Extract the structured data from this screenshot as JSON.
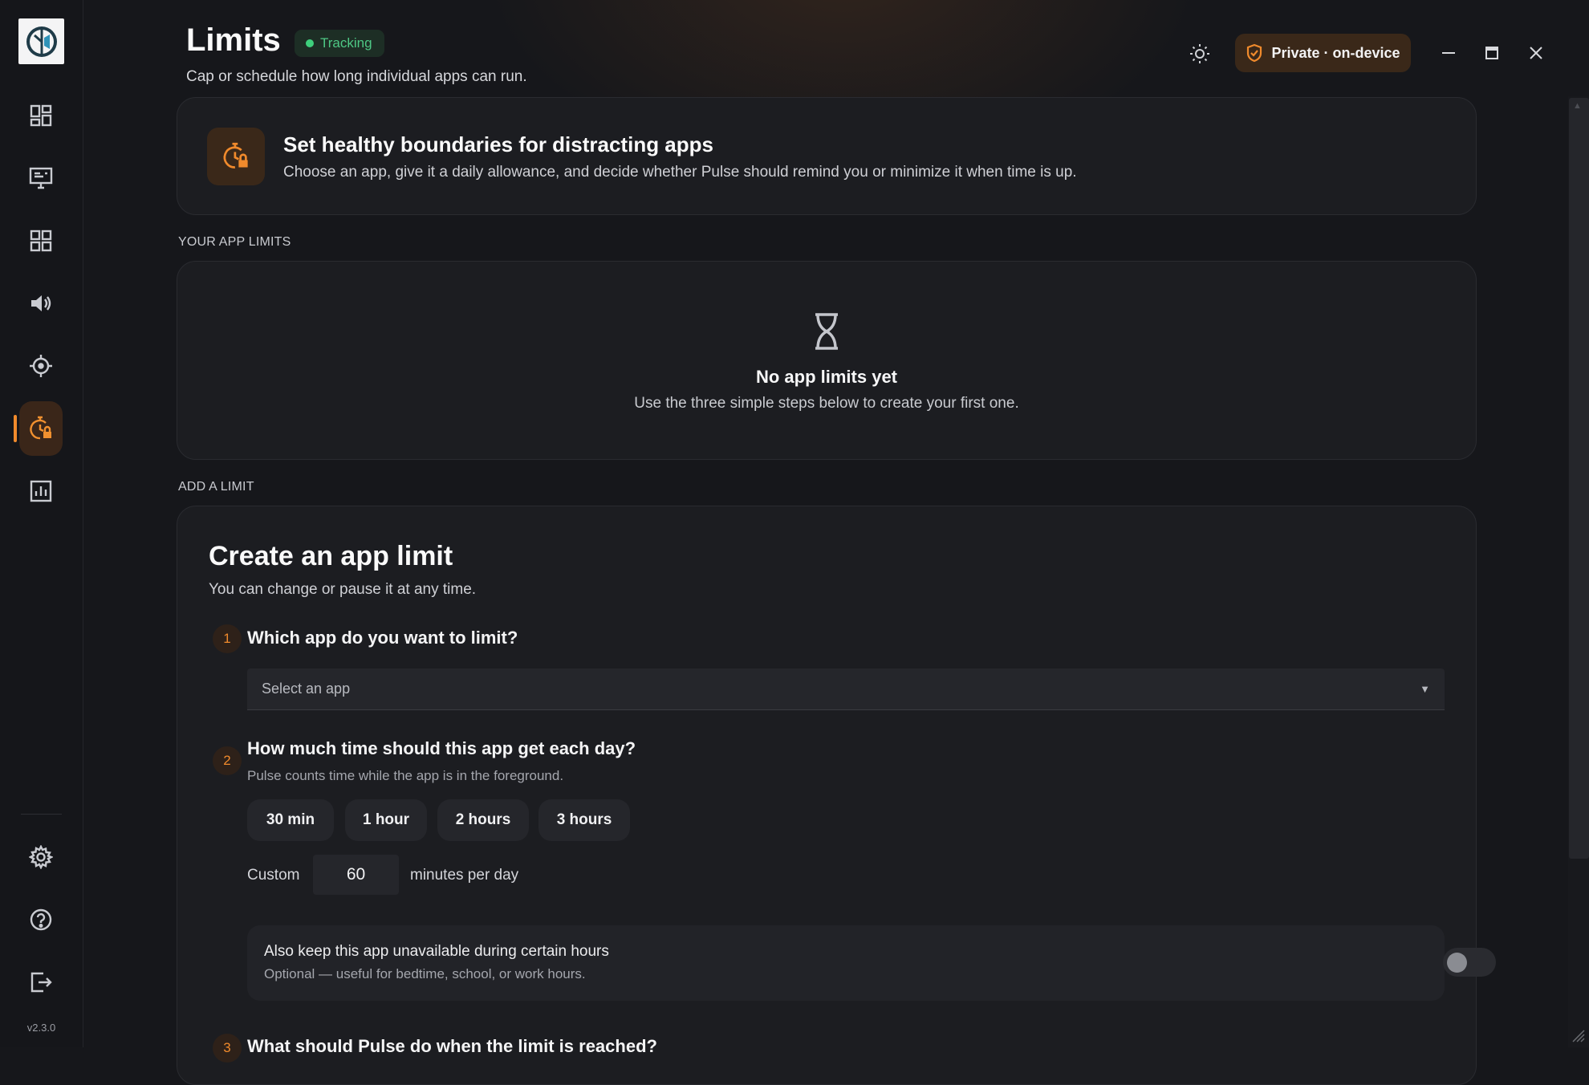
{
  "app": {
    "version": "v2.3.0"
  },
  "header": {
    "title": "Limits",
    "status_badge": "Tracking",
    "subtitle": "Cap or schedule how long individual apps can run.",
    "privacy_label": "Private · on-device"
  },
  "sidebar": {
    "items": [
      {
        "id": "dashboard",
        "icon": "dashboard-icon"
      },
      {
        "id": "screen",
        "icon": "monitor-icon"
      },
      {
        "id": "apps",
        "icon": "apps-grid-icon"
      },
      {
        "id": "sound",
        "icon": "speaker-icon"
      },
      {
        "id": "focus",
        "icon": "crosshair-icon"
      },
      {
        "id": "limits",
        "icon": "timer-lock-icon",
        "active": true
      },
      {
        "id": "reports",
        "icon": "bar-chart-icon"
      }
    ],
    "bottom": [
      {
        "id": "settings",
        "icon": "gear-icon"
      },
      {
        "id": "help",
        "icon": "help-icon"
      },
      {
        "id": "exit",
        "icon": "logout-icon"
      }
    ]
  },
  "hero": {
    "title": "Set healthy boundaries for distracting apps",
    "description": "Choose an app, give it a daily allowance, and decide whether Pulse should remind you or minimize it when time is up."
  },
  "limits_section": {
    "label": "YOUR APP LIMITS",
    "empty_title": "No app limits yet",
    "empty_description": "Use the three simple steps below to create your first one."
  },
  "add_section": {
    "label": "ADD A LIMIT"
  },
  "create": {
    "title": "Create an app limit",
    "subtitle": "You can change or pause it at any time.",
    "step1": {
      "number": "1",
      "question": "Which app do you want to limit?",
      "select_placeholder": "Select an app"
    },
    "step2": {
      "number": "2",
      "question": "How much time should this app get each day?",
      "help": "Pulse counts time while the app is in the foreground.",
      "presets": [
        "30 min",
        "1 hour",
        "2 hours",
        "3 hours"
      ],
      "custom_label": "Custom",
      "custom_value": "60",
      "custom_unit": "minutes per day",
      "schedule_title": "Also keep this app unavailable during certain hours",
      "schedule_sub": "Optional — useful for bedtime, school, or work hours.",
      "schedule_enabled": false
    },
    "step3": {
      "number": "3",
      "question": "What should Pulse do when the limit is reached?"
    }
  },
  "colors": {
    "accent": "#f08a2c",
    "tracking": "#3ecf7c",
    "background": "#16171b",
    "card": "#1c1d21"
  }
}
